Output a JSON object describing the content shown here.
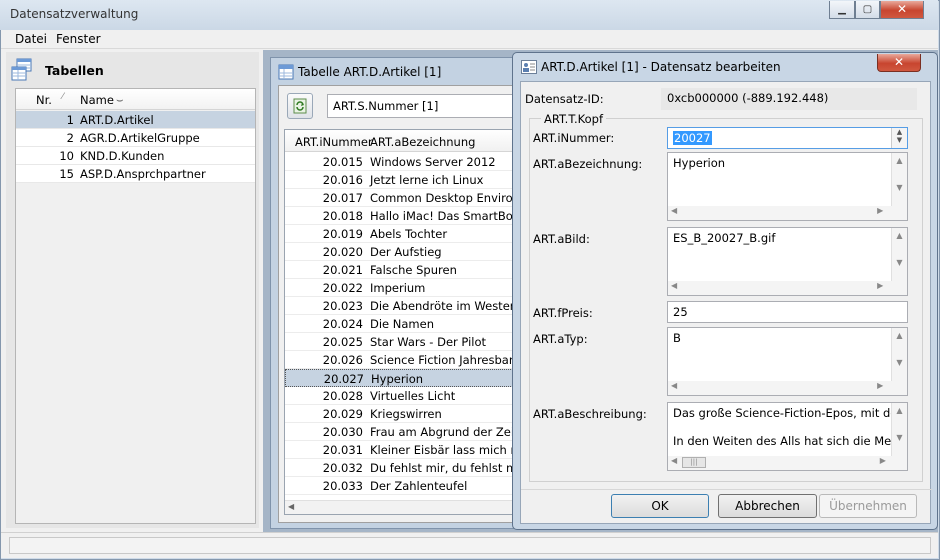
{
  "app": {
    "title": "Datensatzverwaltung"
  },
  "menu": {
    "items": [
      "Datei",
      "Fenster"
    ]
  },
  "tables_panel": {
    "title": "Tabellen",
    "col_nr": "Nr.",
    "col_name": "Name",
    "rows": [
      {
        "nr": "1",
        "name": "ART.D.Artikel"
      },
      {
        "nr": "2",
        "name": "AGR.D.ArtikelGruppe"
      },
      {
        "nr": "10",
        "name": "KND.D.Kunden"
      },
      {
        "nr": "15",
        "name": "ASP.D.Ansprchpartner"
      }
    ],
    "selected_index": 0
  },
  "table_window": {
    "title": "Tabelle ART.D.Artikel [1]",
    "index_combo": "ART.S.Nummer [1]",
    "col_num": "ART.iNummer",
    "col_name": "ART.aBezeichnung",
    "rows": [
      {
        "num": "20.015",
        "name": "Windows Server 2012"
      },
      {
        "num": "20.016",
        "name": "Jetzt lerne ich Linux"
      },
      {
        "num": "20.017",
        "name": "Common Desktop Environm"
      },
      {
        "num": "20.018",
        "name": "Hallo iMac! Das SmartBook"
      },
      {
        "num": "20.019",
        "name": "Abels Tochter"
      },
      {
        "num": "20.020",
        "name": "Der Aufstieg"
      },
      {
        "num": "20.021",
        "name": "Falsche Spuren"
      },
      {
        "num": "20.022",
        "name": "Imperium"
      },
      {
        "num": "20.023",
        "name": "Die Abendröte im Westen"
      },
      {
        "num": "20.024",
        "name": "Die Namen"
      },
      {
        "num": "20.025",
        "name": "Star Wars - Der Pilot"
      },
      {
        "num": "20.026",
        "name": "Science Fiction Jahresband"
      },
      {
        "num": "20.027",
        "name": "Hyperion"
      },
      {
        "num": "20.028",
        "name": "Virtuelles Licht"
      },
      {
        "num": "20.029",
        "name": "Kriegswirren"
      },
      {
        "num": "20.030",
        "name": "Frau am Abgrund der Zeit"
      },
      {
        "num": "20.031",
        "name": "Kleiner Eisbär lass mich nich"
      },
      {
        "num": "20.032",
        "name": "Du fehlst mir, du fehlst mir!"
      },
      {
        "num": "20.033",
        "name": "Der Zahlenteufel"
      }
    ],
    "selected_index": 12
  },
  "dialog": {
    "title": "ART.D.Artikel [1] - Datensatz bearbeiten",
    "record_id_label": "Datensatz-ID:",
    "record_id_value": "0xcb000000 (-889.192.448)",
    "group_label": "ART.T.Kopf",
    "fields": {
      "nummer_label": "ART.iNummer:",
      "nummer_value": "20027",
      "bezeichnung_label": "ART.aBezeichnung:",
      "bezeichnung_value": "Hyperion",
      "bild_label": "ART.aBild:",
      "bild_value": "ES_B_20027_B.gif",
      "preis_label": "ART.fPreis:",
      "preis_value": "25",
      "typ_label": "ART.aTyp:",
      "typ_value": "B",
      "beschreibung_label": "ART.aBeschreibung:",
      "beschreibung_line1": "Das große Science-Fiction-Epos, mit dem",
      "beschreibung_line2": "In den Weiten des Alls hat sich die Mensch"
    },
    "buttons": {
      "ok": "OK",
      "cancel": "Abbrechen",
      "apply": "Übernehmen"
    }
  }
}
